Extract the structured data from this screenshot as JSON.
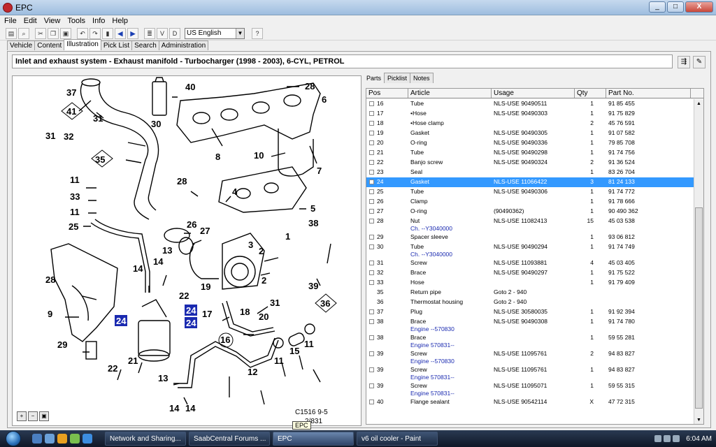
{
  "window": {
    "title": "EPC",
    "minimize": "_",
    "maximize": "□",
    "close": "X"
  },
  "menu": [
    "File",
    "Edit",
    "View",
    "Tools",
    "Info",
    "Help"
  ],
  "toolbar": {
    "language": "US English"
  },
  "tabs": [
    "Vehicle",
    "Content",
    "Illustration",
    "Pick List",
    "Search",
    "Administration"
  ],
  "heading": "Inlet and exhaust system - Exhaust manifold - Turbocharger   (1998 - 2003), 6-CYL, PETROL",
  "right_tabs": [
    "Parts",
    "Picklist",
    "Notes"
  ],
  "columns": [
    "Pos",
    "Article",
    "Usage",
    "Qty",
    "Part No."
  ],
  "parts": [
    {
      "pos": "16",
      "article": "Tube",
      "usage": "NLS-USE 90490511",
      "qty": "1",
      "partno": "91 85 455"
    },
    {
      "pos": "17",
      "article": "•Hose",
      "usage": "NLS-USE 90490303",
      "qty": "1",
      "partno": "91 75 829"
    },
    {
      "pos": "18",
      "article": "•Hose clamp",
      "usage": "",
      "qty": "2",
      "partno": "45 76 591"
    },
    {
      "pos": "19",
      "article": "Gasket",
      "usage": "NLS-USE 90490305",
      "qty": "1",
      "partno": "91 07 582"
    },
    {
      "pos": "20",
      "article": "O-ring",
      "usage": "NLS-USE 90490336",
      "qty": "1",
      "partno": "79 85 708"
    },
    {
      "pos": "21",
      "article": "Tube",
      "usage": "NLS-USE 90490298",
      "qty": "1",
      "partno": "91 74 756"
    },
    {
      "pos": "22",
      "article": "Banjo screw",
      "usage": "NLS-USE 90490324",
      "qty": "2",
      "partno": "91 36 524"
    },
    {
      "pos": "23",
      "article": "Seal",
      "usage": "",
      "qty": "1",
      "partno": "83 26 704"
    },
    {
      "pos": "24",
      "article": "Gasket",
      "usage": "NLS-USE 11066422",
      "qty": "3",
      "partno": "81 24 133",
      "selected": true
    },
    {
      "pos": "25",
      "article": "Tube",
      "usage": "NLS-USE 90490306",
      "qty": "1",
      "partno": "91 74 772"
    },
    {
      "pos": "26",
      "article": "Clamp",
      "usage": "",
      "qty": "1",
      "partno": "91 78 666"
    },
    {
      "pos": "27",
      "article": "O-ring",
      "usage": "(90490362)",
      "qty": "1",
      "partno": "90 490 362"
    },
    {
      "pos": "28",
      "article": "Nut",
      "sub": "Ch. --Y3040000",
      "usage": "NLS-USE 11082413",
      "qty": "15",
      "partno": "45 03 538"
    },
    {
      "pos": "29",
      "article": "Spacer sleeve",
      "usage": "",
      "qty": "1",
      "partno": "93 06 812"
    },
    {
      "pos": "30",
      "article": "Tube",
      "sub": "Ch. --Y3040000",
      "usage": "NLS-USE 90490294",
      "qty": "1",
      "partno": "91 74 749"
    },
    {
      "pos": "31",
      "article": "Screw",
      "usage": "NLS-USE 11093881",
      "qty": "4",
      "partno": "45 03 405"
    },
    {
      "pos": "32",
      "article": "Brace",
      "usage": "NLS-USE 90490297",
      "qty": "1",
      "partno": "91 75 522"
    },
    {
      "pos": "33",
      "article": "Hose",
      "usage": "",
      "qty": "1",
      "partno": "91 79 409"
    },
    {
      "pos": "35",
      "article": "Return pipe",
      "usage": "Goto 2 - 940",
      "qty": "",
      "partno": "",
      "nocheck": true
    },
    {
      "pos": "36",
      "article": "Thermostat housing",
      "usage": "Goto 2 - 940",
      "qty": "",
      "partno": "",
      "nocheck": true
    },
    {
      "pos": "37",
      "article": "Plug",
      "usage": "NLS-USE 30580035",
      "qty": "1",
      "partno": "91 92 394"
    },
    {
      "pos": "38",
      "article": "Brace",
      "sub": "Engine --570830",
      "usage": "NLS-USE 90490308",
      "qty": "1",
      "partno": "91 74 780"
    },
    {
      "pos": "38",
      "article": "Brace",
      "sub": "Engine 570831--",
      "usage": "",
      "qty": "1",
      "partno": "59 55 281"
    },
    {
      "pos": "39",
      "article": "Screw",
      "sub": "Engine --570830",
      "usage": "NLS-USE 11095761",
      "qty": "2",
      "partno": "94 83 827"
    },
    {
      "pos": "39",
      "article": "Screw",
      "sub": "Engine 570831--",
      "usage": "NLS-USE 11095761",
      "qty": "1",
      "partno": "94 83 827"
    },
    {
      "pos": "39",
      "article": "Screw",
      "sub": "Engine 570831--",
      "usage": "NLS-USE 11095071",
      "qty": "1",
      "partno": "59 55 315"
    },
    {
      "pos": "40",
      "article": "Flange sealant",
      "usage": "NLS-USE 90542114",
      "qty": "X",
      "partno": "47 72 315"
    }
  ],
  "illustration": {
    "code_line1": "C1516 9-5",
    "code_line2": "2/831",
    "callouts": [
      "37",
      "40",
      "28",
      "6",
      "31",
      "41",
      "32",
      "30",
      "8",
      "10",
      "7",
      "35",
      "11",
      "33",
      "28",
      "4",
      "5",
      "11",
      "25",
      "26",
      "27",
      "1",
      "38",
      "3",
      "2",
      "13",
      "14",
      "14",
      "2",
      "39",
      "28",
      "9",
      "24",
      "22",
      "24",
      "19",
      "31",
      "24",
      "17",
      "18",
      "20",
      "36",
      "29",
      "21",
      "16",
      "12",
      "11",
      "15",
      "11",
      "13",
      "14",
      "14",
      "22"
    ]
  },
  "tooltip": "EPC",
  "taskbar": {
    "items": [
      "Network and Sharing...",
      "SaabCentral Forums ...",
      "EPC",
      "v6 oil cooler - Paint"
    ],
    "time": "6:04 AM"
  }
}
